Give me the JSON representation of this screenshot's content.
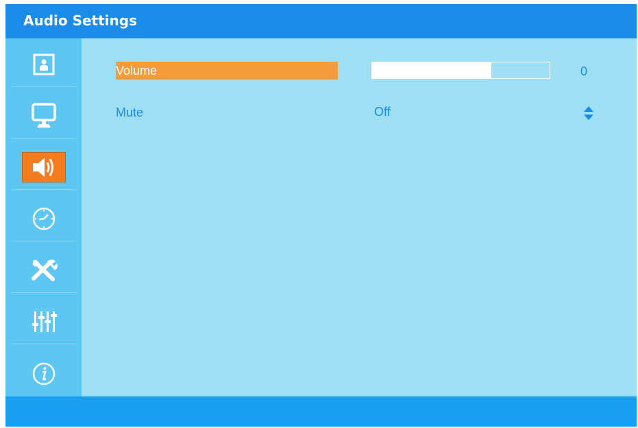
{
  "window": {
    "title": "Audio Settings"
  },
  "sidebar": {
    "items": [
      {
        "name": "picture",
        "icon": "picture-icon",
        "active": false
      },
      {
        "name": "display",
        "icon": "monitor-icon",
        "active": false
      },
      {
        "name": "audio",
        "icon": "speaker-icon",
        "active": true
      },
      {
        "name": "timer",
        "icon": "clock-icon",
        "active": false
      },
      {
        "name": "setup",
        "icon": "tools-icon",
        "active": false
      },
      {
        "name": "adjust",
        "icon": "sliders-icon",
        "active": false
      },
      {
        "name": "information",
        "icon": "info-icon",
        "active": false
      }
    ]
  },
  "settings": {
    "volume": {
      "label": "Volume",
      "value": "0",
      "level_fraction": 0.67
    },
    "mute": {
      "label": "Mute",
      "value": "Off"
    }
  },
  "colors": {
    "title_bar": "#1a8be6",
    "sidebar": "#5ec6f2",
    "content": "#9edff4",
    "selection": "#f49b3c",
    "active_tab": "#f47b1e",
    "label_text": "#1a8be6"
  }
}
